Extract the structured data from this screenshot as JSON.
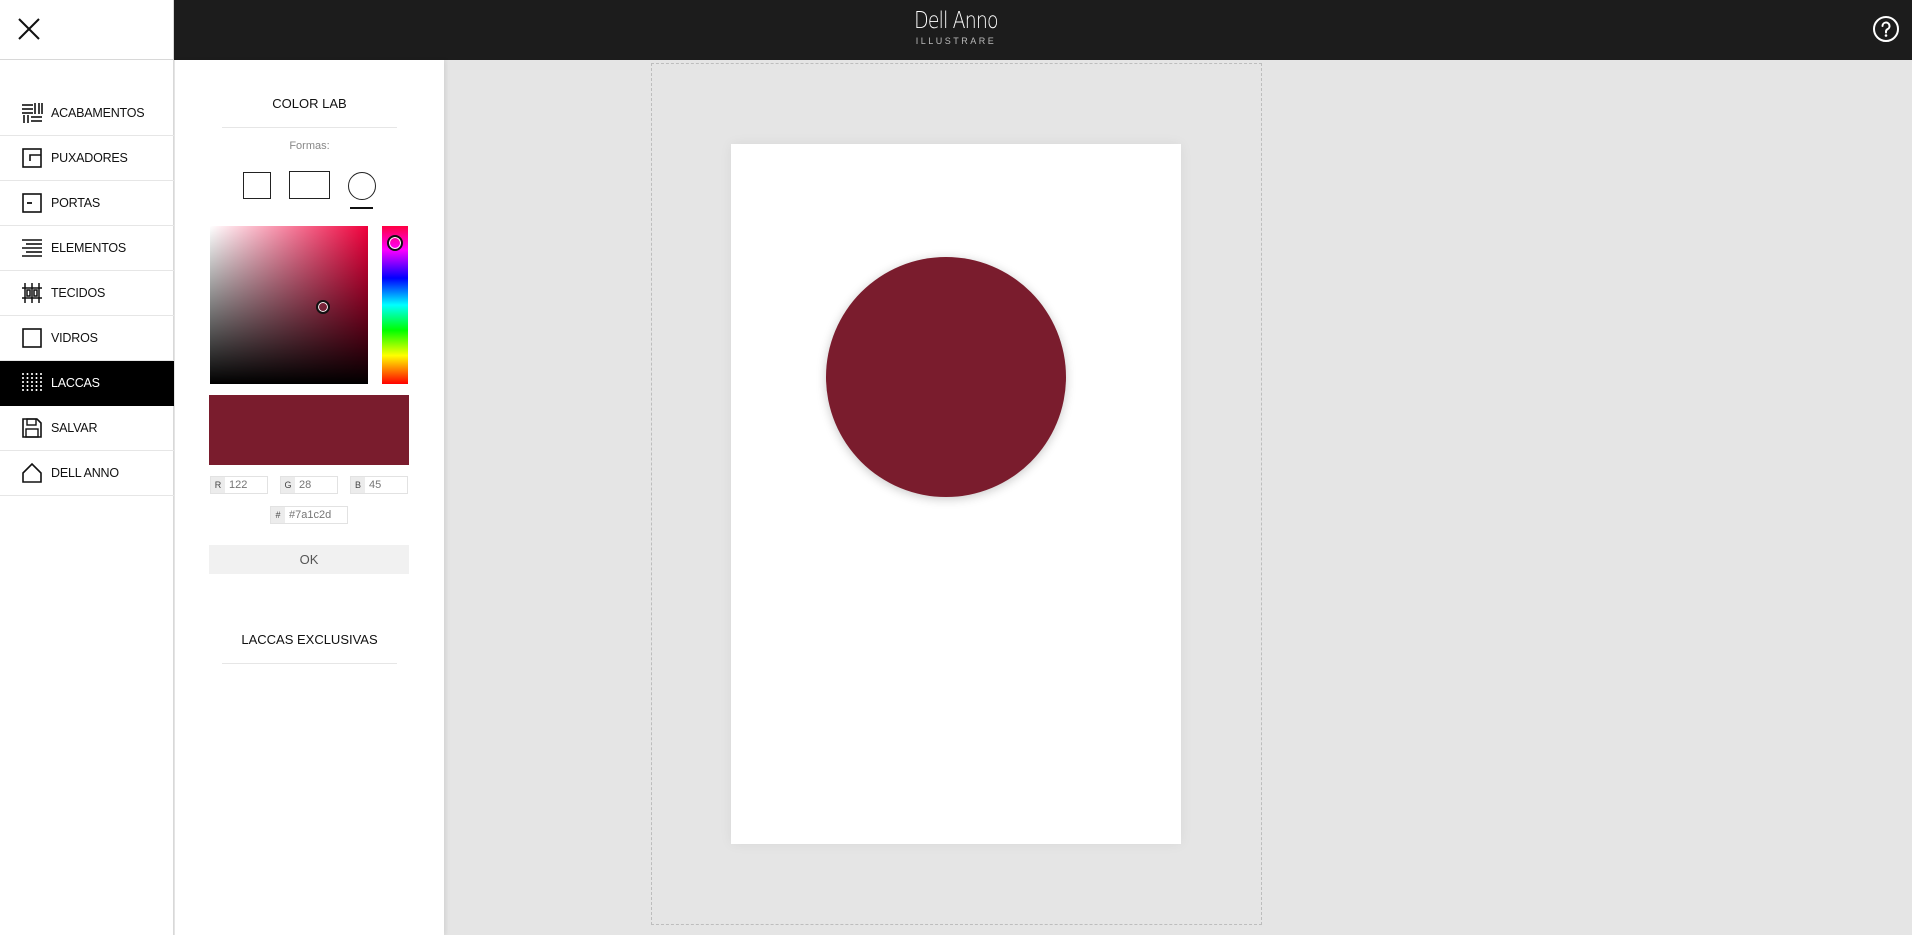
{
  "header": {
    "brand_name": "Dell Anno",
    "brand_sub": "ILLUSTRARE"
  },
  "sidebar": {
    "items": [
      {
        "label": "ACABAMENTOS",
        "icon": "finishes-icon",
        "active": false
      },
      {
        "label": "PUXADORES",
        "icon": "handle-icon",
        "active": false
      },
      {
        "label": "PORTAS",
        "icon": "door-icon",
        "active": false
      },
      {
        "label": "ELEMENTOS",
        "icon": "elements-icon",
        "active": false
      },
      {
        "label": "TECIDOS",
        "icon": "fabric-icon",
        "active": false
      },
      {
        "label": "VIDROS",
        "icon": "glass-icon",
        "active": false
      },
      {
        "label": "LACCAS",
        "icon": "lacquer-icon",
        "active": true
      },
      {
        "label": "SALVAR",
        "icon": "save-icon",
        "active": false
      },
      {
        "label": "DELL ANNO",
        "icon": "home-icon",
        "active": false
      }
    ]
  },
  "panel": {
    "title": "COLOR LAB",
    "formas_label": "Formas:",
    "shapes": [
      "square",
      "rectangle",
      "circle"
    ],
    "selected_shape": "circle",
    "color": {
      "r_tag": "R",
      "r": "122",
      "g_tag": "G",
      "g": "28",
      "b_tag": "B",
      "b": "45",
      "hex_tag": "#",
      "hex": "#7a1c2d"
    },
    "ok_label": "OK",
    "exclusive_title": "LACCAS EXCLUSIVAS"
  },
  "colors": {
    "selected": "#7a1c2d",
    "topbar": "#1c1c1c",
    "active_menu": "#000000"
  }
}
